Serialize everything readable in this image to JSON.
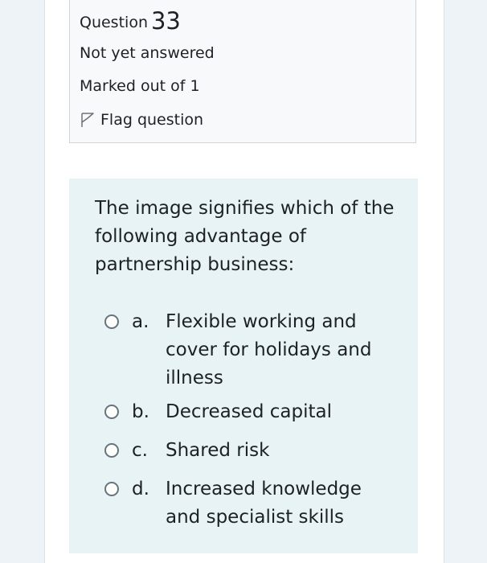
{
  "question_info": {
    "label": "Question",
    "number": "33",
    "state": "Not yet answered",
    "grade": "Marked out of 1",
    "flag_label": "Flag question"
  },
  "question": {
    "text": "The image signifies which of the following advantage of partnership business:",
    "options": [
      {
        "letter": "a.",
        "text": "Flexible working and cover for holidays and illness"
      },
      {
        "letter": "b.",
        "text": "Decreased capital"
      },
      {
        "letter": "c.",
        "text": "Shared risk"
      },
      {
        "letter": "d.",
        "text": "Increased knowledge and specialist skills"
      }
    ]
  },
  "colors": {
    "page_background": "#eef3f7",
    "info_background": "#f8f9fa",
    "formulation_background": "#e7f3f5",
    "text": "#1d2125"
  }
}
